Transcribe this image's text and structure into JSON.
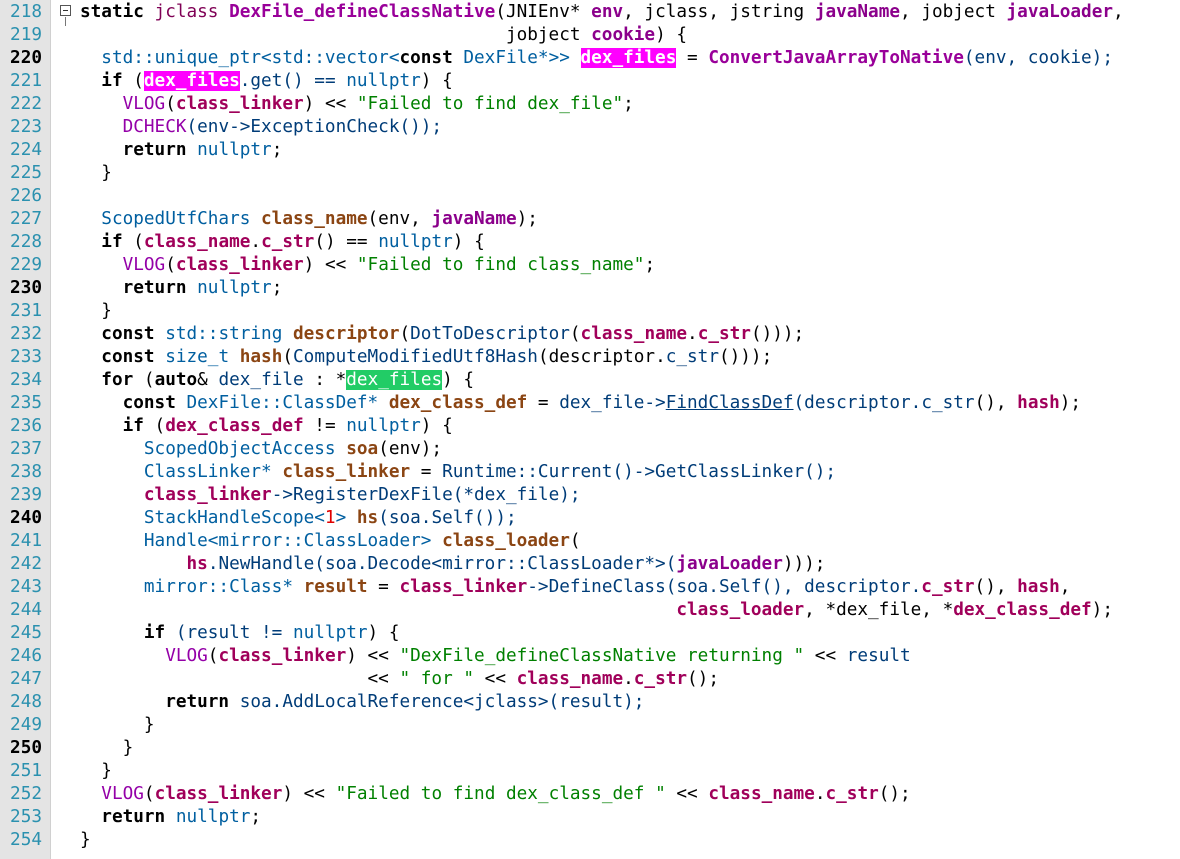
{
  "editor": {
    "lines": [
      {
        "num": "218",
        "mod": false,
        "fold": true,
        "segs": [
          [
            "static ",
            "kw"
          ],
          [
            "jclass ",
            "type"
          ],
          [
            "DexFile_defineClassNative",
            "func"
          ],
          [
            "(JNIEnv* ",
            "plain"
          ],
          [
            "env",
            "param"
          ],
          [
            ", jclass, jstring ",
            "plain"
          ],
          [
            "javaName",
            "param"
          ],
          [
            ", jobject ",
            "plain"
          ],
          [
            "javaLoader",
            "param"
          ],
          [
            ",",
            "plain"
          ]
        ]
      },
      {
        "num": "219",
        "mod": false,
        "segs": [
          [
            "                                        jobject ",
            "plain"
          ],
          [
            "cookie",
            "param"
          ],
          [
            ") {",
            "plain"
          ]
        ]
      },
      {
        "num": "220",
        "mod": true,
        "segs": [
          [
            "  std::unique_ptr<std::vector<",
            "typename"
          ],
          [
            "const ",
            "kw"
          ],
          [
            "DexFile*>> ",
            "typename"
          ],
          [
            "dex_files",
            "hlm"
          ],
          [
            " = ",
            "plain"
          ],
          [
            "ConvertJavaArrayToNative",
            "func"
          ],
          [
            "(env, cookie);",
            "call"
          ]
        ]
      },
      {
        "num": "221",
        "mod": false,
        "segs": [
          [
            "  if ",
            "kw"
          ],
          [
            "(",
            "plain"
          ],
          [
            "dex_files",
            "hlm"
          ],
          [
            ".get() == ",
            "call"
          ],
          [
            "nullptr",
            "typename"
          ],
          [
            ") {",
            "plain"
          ]
        ]
      },
      {
        "num": "222",
        "mod": false,
        "segs": [
          [
            "    VLOG",
            "macro"
          ],
          [
            "(",
            "plain"
          ],
          [
            "class_linker",
            "local"
          ],
          [
            ") << ",
            "plain"
          ],
          [
            "\"Failed to find dex_file\"",
            "str"
          ],
          [
            ";",
            "plain"
          ]
        ]
      },
      {
        "num": "223",
        "mod": false,
        "segs": [
          [
            "    DCHECK",
            "macro"
          ],
          [
            "(env->ExceptionCheck());",
            "call"
          ]
        ]
      },
      {
        "num": "224",
        "mod": false,
        "segs": [
          [
            "    return ",
            "kw"
          ],
          [
            "nullptr",
            "typename"
          ],
          [
            ";",
            "plain"
          ]
        ]
      },
      {
        "num": "225",
        "mod": false,
        "segs": [
          [
            "  }",
            "plain"
          ]
        ]
      },
      {
        "num": "226",
        "mod": false,
        "segs": [
          [
            "",
            "plain"
          ]
        ]
      },
      {
        "num": "227",
        "mod": false,
        "segs": [
          [
            "  ScopedUtfChars ",
            "typename"
          ],
          [
            "class_name",
            "var"
          ],
          [
            "(env, ",
            "plain"
          ],
          [
            "javaName",
            "param"
          ],
          [
            ");",
            "plain"
          ]
        ]
      },
      {
        "num": "228",
        "mod": false,
        "segs": [
          [
            "  if ",
            "kw"
          ],
          [
            "(",
            "plain"
          ],
          [
            "class_name",
            "local"
          ],
          [
            ".",
            "plain"
          ],
          [
            "c_str",
            "local"
          ],
          [
            "() == ",
            "plain"
          ],
          [
            "nullptr",
            "typename"
          ],
          [
            ") {",
            "plain"
          ]
        ]
      },
      {
        "num": "229",
        "mod": false,
        "segs": [
          [
            "    VLOG",
            "macro"
          ],
          [
            "(",
            "plain"
          ],
          [
            "class_linker",
            "local"
          ],
          [
            ") << ",
            "plain"
          ],
          [
            "\"Failed to find class_name\"",
            "str"
          ],
          [
            ";",
            "plain"
          ]
        ]
      },
      {
        "num": "230",
        "mod": true,
        "segs": [
          [
            "    return ",
            "kw"
          ],
          [
            "nullptr",
            "typename"
          ],
          [
            ";",
            "plain"
          ]
        ]
      },
      {
        "num": "231",
        "mod": false,
        "segs": [
          [
            "  }",
            "plain"
          ]
        ]
      },
      {
        "num": "232",
        "mod": false,
        "segs": [
          [
            "  const ",
            "kw"
          ],
          [
            "std::string ",
            "typename"
          ],
          [
            "descriptor",
            "var"
          ],
          [
            "(",
            "plain"
          ],
          [
            "DotToDescriptor",
            "call"
          ],
          [
            "(",
            "plain"
          ],
          [
            "class_name",
            "local"
          ],
          [
            ".",
            "plain"
          ],
          [
            "c_str",
            "local"
          ],
          [
            "()));",
            "plain"
          ]
        ]
      },
      {
        "num": "233",
        "mod": false,
        "segs": [
          [
            "  const ",
            "kw"
          ],
          [
            "size_t ",
            "typename"
          ],
          [
            "hash",
            "var"
          ],
          [
            "(",
            "plain"
          ],
          [
            "ComputeModifiedUtf8Hash",
            "call"
          ],
          [
            "(descriptor.",
            "plain"
          ],
          [
            "c_str",
            "call"
          ],
          [
            "()));",
            "plain"
          ]
        ]
      },
      {
        "num": "234",
        "mod": false,
        "segs": [
          [
            "  for ",
            "kw"
          ],
          [
            "(",
            "plain"
          ],
          [
            "auto",
            "kw"
          ],
          [
            "& ",
            "plain"
          ],
          [
            "dex_file ",
            "call"
          ],
          [
            ": *",
            "plain"
          ],
          [
            "dex_files",
            "hlg"
          ],
          [
            ") {",
            "plain"
          ]
        ]
      },
      {
        "num": "235",
        "mod": false,
        "segs": [
          [
            "    const ",
            "kw"
          ],
          [
            "DexFile::ClassDef* ",
            "typename"
          ],
          [
            "dex_class_def",
            "var"
          ],
          [
            " = ",
            "plain"
          ],
          [
            "dex_file->",
            "call"
          ],
          [
            "FindClassDef",
            "ul"
          ],
          [
            "(descriptor.",
            "call"
          ],
          [
            "c_str",
            "call"
          ],
          [
            "(), ",
            "plain"
          ],
          [
            "hash",
            "local"
          ],
          [
            ");",
            "plain"
          ]
        ]
      },
      {
        "num": "236",
        "mod": false,
        "segs": [
          [
            "    if ",
            "kw"
          ],
          [
            "(",
            "plain"
          ],
          [
            "dex_class_def",
            "local"
          ],
          [
            " != ",
            "plain"
          ],
          [
            "nullptr",
            "typename"
          ],
          [
            ") {",
            "plain"
          ]
        ]
      },
      {
        "num": "237",
        "mod": false,
        "segs": [
          [
            "      ScopedObjectAccess ",
            "typename"
          ],
          [
            "soa",
            "var"
          ],
          [
            "(env);",
            "plain"
          ]
        ]
      },
      {
        "num": "238",
        "mod": false,
        "segs": [
          [
            "      ClassLinker* ",
            "typename"
          ],
          [
            "class_linker",
            "var"
          ],
          [
            " = ",
            "plain"
          ],
          [
            "Runtime::Current()->GetClassLinker();",
            "call"
          ]
        ]
      },
      {
        "num": "239",
        "mod": false,
        "segs": [
          [
            "      ",
            "plain"
          ],
          [
            "class_linker",
            "local"
          ],
          [
            "->RegisterDexFile(*dex_file);",
            "call"
          ]
        ]
      },
      {
        "num": "240",
        "mod": true,
        "segs": [
          [
            "      StackHandleScope<",
            "typename"
          ],
          [
            "1",
            "num"
          ],
          [
            "> ",
            "typename"
          ],
          [
            "hs",
            "var"
          ],
          [
            "(soa.Self());",
            "call"
          ]
        ]
      },
      {
        "num": "241",
        "mod": false,
        "segs": [
          [
            "      Handle<mirror::ClassLoader> ",
            "typename"
          ],
          [
            "class_loader",
            "var"
          ],
          [
            "(",
            "plain"
          ]
        ]
      },
      {
        "num": "242",
        "mod": false,
        "segs": [
          [
            "          ",
            "plain"
          ],
          [
            "hs",
            "local"
          ],
          [
            ".NewHandle(soa.Decode<mirror::ClassLoader*>(",
            "call"
          ],
          [
            "javaLoader",
            "param"
          ],
          [
            ")));",
            "plain"
          ]
        ]
      },
      {
        "num": "243",
        "mod": false,
        "segs": [
          [
            "      mirror::Class* ",
            "typename"
          ],
          [
            "result",
            "var"
          ],
          [
            " = ",
            "plain"
          ],
          [
            "class_linker",
            "local"
          ],
          [
            "->DefineClass(soa.Self(), descriptor.",
            "call"
          ],
          [
            "c_str",
            "local"
          ],
          [
            "(), ",
            "plain"
          ],
          [
            "hash",
            "local"
          ],
          [
            ",",
            "plain"
          ]
        ]
      },
      {
        "num": "244",
        "mod": false,
        "segs": [
          [
            "                                                        ",
            "plain"
          ],
          [
            "class_loader",
            "local"
          ],
          [
            ", *dex_file, *",
            "plain"
          ],
          [
            "dex_class_def",
            "local"
          ],
          [
            ");",
            "plain"
          ]
        ]
      },
      {
        "num": "245",
        "mod": false,
        "segs": [
          [
            "      if ",
            "kw"
          ],
          [
            "(result != ",
            "call"
          ],
          [
            "nullptr",
            "typename"
          ],
          [
            ") {",
            "plain"
          ]
        ]
      },
      {
        "num": "246",
        "mod": false,
        "segs": [
          [
            "        VLOG",
            "macro"
          ],
          [
            "(",
            "plain"
          ],
          [
            "class_linker",
            "local"
          ],
          [
            ") << ",
            "plain"
          ],
          [
            "\"DexFile_defineClassNative returning \"",
            "str"
          ],
          [
            " << ",
            "plain"
          ],
          [
            "result",
            "call"
          ]
        ]
      },
      {
        "num": "247",
        "mod": false,
        "segs": [
          [
            "                           << ",
            "plain"
          ],
          [
            "\" for \"",
            "str"
          ],
          [
            " << ",
            "plain"
          ],
          [
            "class_name",
            "local"
          ],
          [
            ".",
            "plain"
          ],
          [
            "c_str",
            "local"
          ],
          [
            "();",
            "plain"
          ]
        ]
      },
      {
        "num": "248",
        "mod": false,
        "segs": [
          [
            "        return ",
            "kw"
          ],
          [
            "soa.AddLocalReference<jclass>(result);",
            "call"
          ]
        ]
      },
      {
        "num": "249",
        "mod": false,
        "segs": [
          [
            "      }",
            "plain"
          ]
        ]
      },
      {
        "num": "250",
        "mod": true,
        "segs": [
          [
            "    }",
            "plain"
          ]
        ]
      },
      {
        "num": "251",
        "mod": false,
        "segs": [
          [
            "  }",
            "plain"
          ]
        ]
      },
      {
        "num": "252",
        "mod": false,
        "segs": [
          [
            "  VLOG",
            "macro"
          ],
          [
            "(",
            "plain"
          ],
          [
            "class_linker",
            "local"
          ],
          [
            ") << ",
            "plain"
          ],
          [
            "\"Failed to find dex_class_def \"",
            "str"
          ],
          [
            " << ",
            "plain"
          ],
          [
            "class_name",
            "local"
          ],
          [
            ".",
            "plain"
          ],
          [
            "c_str",
            "local"
          ],
          [
            "();",
            "plain"
          ]
        ]
      },
      {
        "num": "253",
        "mod": false,
        "segs": [
          [
            "  return ",
            "kw"
          ],
          [
            "nullptr",
            "typename"
          ],
          [
            ";",
            "plain"
          ]
        ]
      },
      {
        "num": "254",
        "mod": false,
        "segs": [
          [
            "}",
            "plain"
          ]
        ]
      }
    ]
  },
  "colors": {
    "gutter_bg": "#e4e4e4",
    "line_number": "#2b91af",
    "highlight_magenta": "#ff00ff",
    "highlight_green": "#22cc66",
    "string": "#008000",
    "macro": "#9400a8"
  }
}
